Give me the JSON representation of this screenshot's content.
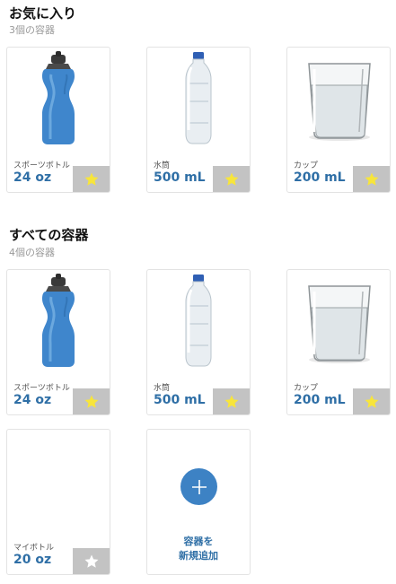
{
  "favorites": {
    "title": "お気に入り",
    "count": "3個の容器",
    "items": [
      {
        "label": "スポーツボトル",
        "volume": "24 oz",
        "favorite": true,
        "icon": "sports-bottle-image"
      },
      {
        "label": "水筒",
        "volume": "500 mL",
        "favorite": true,
        "icon": "water-bottle-image"
      },
      {
        "label": "カップ",
        "volume": "200 mL",
        "favorite": true,
        "icon": "glass-cup-image"
      }
    ]
  },
  "all_containers": {
    "title": "すべての容器",
    "count": "4個の容器",
    "items": [
      {
        "label": "スポーツボトル",
        "volume": "24 oz",
        "favorite": true,
        "icon": "sports-bottle-image"
      },
      {
        "label": "水筒",
        "volume": "500 mL",
        "favorite": true,
        "icon": "water-bottle-image"
      },
      {
        "label": "カップ",
        "volume": "200 mL",
        "favorite": true,
        "icon": "glass-cup-image"
      },
      {
        "label": "マイボトル",
        "volume": "20 oz",
        "favorite": false,
        "icon": ""
      }
    ],
    "add_button": {
      "line1": "容器を",
      "line2": "新規追加",
      "icon": "plus-icon"
    }
  },
  "colors": {
    "accent": "#2f6fa6",
    "add_circle": "#3d82c4",
    "star_active": "#f7e53b",
    "star_inactive": "#ffffff",
    "fav_bg": "#c3c3c3"
  }
}
